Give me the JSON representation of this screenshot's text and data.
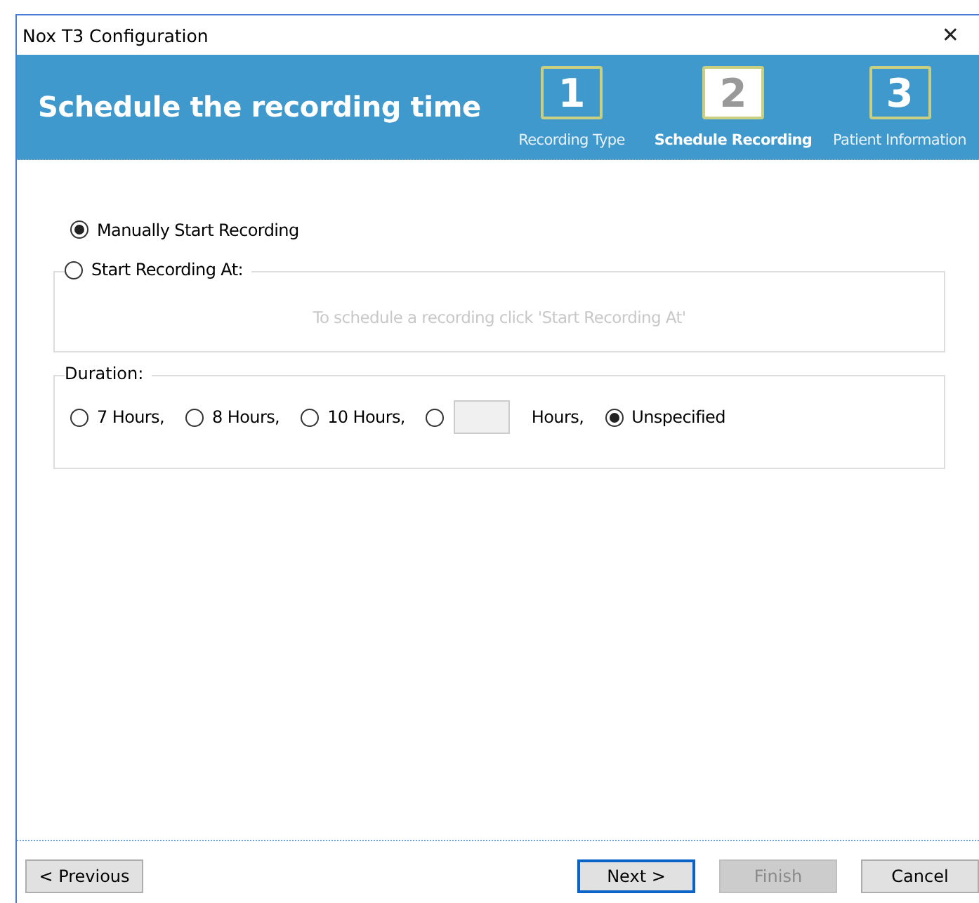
{
  "window": {
    "title": "Nox T3 Configuration",
    "close": "✕"
  },
  "header": {
    "title": "Schedule the recording time",
    "steps": [
      {
        "number": "1",
        "label": "Recording Type",
        "selected": false
      },
      {
        "number": "2",
        "label": "Schedule Recording",
        "selected": true
      },
      {
        "number": "3",
        "label": "Patient Information",
        "selected": false
      }
    ]
  },
  "start": {
    "manual": {
      "label": "Manually Start Recording",
      "selected": true
    },
    "scheduled": {
      "label": "Start Recording At:",
      "selected": false,
      "hint": "To schedule a recording click 'Start Recording At'"
    }
  },
  "duration": {
    "label": "Duration:",
    "options": [
      {
        "kind": "radio",
        "label": "7 Hours,",
        "selected": false
      },
      {
        "kind": "radio",
        "label": "8 Hours,",
        "selected": false
      },
      {
        "kind": "radio",
        "label": "10 Hours,",
        "selected": false
      },
      {
        "kind": "custom",
        "label": "Hours,",
        "selected": false
      },
      {
        "kind": "radio",
        "label": "Unspecified",
        "selected": true
      }
    ]
  },
  "buttons": [
    {
      "label": "< Previous",
      "disabled": false,
      "default": false
    },
    {
      "label": "Next >",
      "disabled": false,
      "default": true
    },
    {
      "label": "Finish",
      "disabled": true,
      "default": false
    },
    {
      "label": "Cancel",
      "disabled": false,
      "default": false
    }
  ]
}
